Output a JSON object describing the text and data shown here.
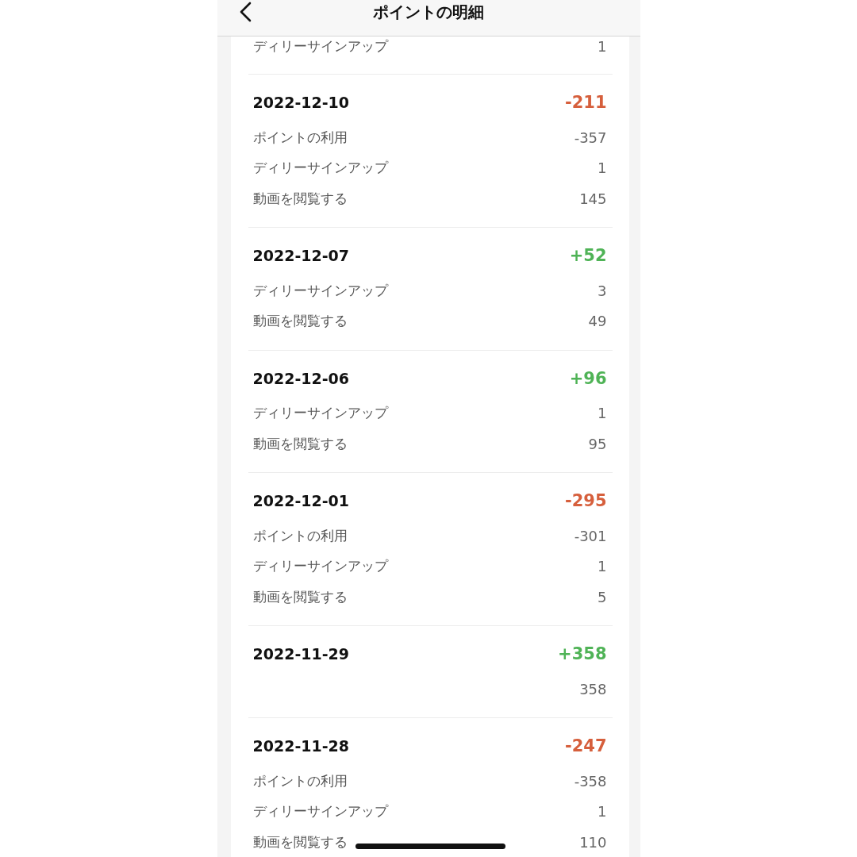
{
  "header": {
    "title": "ポイントの明細"
  },
  "partial_entry": {
    "items": [
      {
        "label": "ディリーサインアップ",
        "value": "1"
      }
    ]
  },
  "entries": [
    {
      "date": "2022-12-10",
      "total": "-211",
      "color": "#d65f3c",
      "items": [
        {
          "label": "ポイントの利用",
          "value": "-357"
        },
        {
          "label": "ディリーサインアップ",
          "value": "1"
        },
        {
          "label": "動画を閲覧する",
          "value": "145"
        }
      ]
    },
    {
      "date": "2022-12-07",
      "total": "+52",
      "color": "#4fb356",
      "items": [
        {
          "label": "ディリーサインアップ",
          "value": "3"
        },
        {
          "label": "動画を閲覧する",
          "value": "49"
        }
      ]
    },
    {
      "date": "2022-12-06",
      "total": "+96",
      "color": "#4fb356",
      "items": [
        {
          "label": "ディリーサインアップ",
          "value": "1"
        },
        {
          "label": "動画を閲覧する",
          "value": "95"
        }
      ]
    },
    {
      "date": "2022-12-01",
      "total": "-295",
      "color": "#d65f3c",
      "items": [
        {
          "label": "ポイントの利用",
          "value": "-301"
        },
        {
          "label": "ディリーサインアップ",
          "value": "1"
        },
        {
          "label": "動画を閲覧する",
          "value": "5"
        }
      ]
    },
    {
      "date": "2022-11-29",
      "total": "+358",
      "color": "#4fb356",
      "items": [
        {
          "value": "358"
        }
      ]
    },
    {
      "date": "2022-11-28",
      "total": "-247",
      "color": "#d65f3c",
      "items": [
        {
          "label": "ポイントの利用",
          "value": "-358"
        },
        {
          "label": "ディリーサインアップ",
          "value": "1"
        },
        {
          "label": "動画を閲覧する",
          "value": "110"
        }
      ]
    }
  ]
}
